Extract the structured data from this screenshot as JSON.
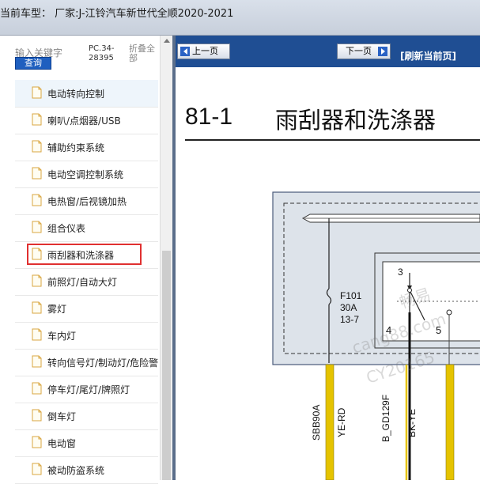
{
  "header": {
    "title": "当前车型：  厂家:J-江铃汽车新世代全顺2020-2021"
  },
  "search": {
    "keyword_label": "输入关键字",
    "button": "查询",
    "pc_code": "PC.34-28395",
    "fold": "折叠全部"
  },
  "tree": [
    {
      "label": "电动转向控制",
      "state": "active"
    },
    {
      "label": "喇叭/点烟器/USB"
    },
    {
      "label": "辅助约束系统"
    },
    {
      "label": "电动空调控制系统"
    },
    {
      "label": "电热窗/后视镜加热"
    },
    {
      "label": "组合仪表"
    },
    {
      "label": "雨刮器和洗涤器",
      "state": "highlighted"
    },
    {
      "label": "前照灯/自动大灯"
    },
    {
      "label": "雾灯"
    },
    {
      "label": "车内灯"
    },
    {
      "label": "转向信号灯/制动灯/危险警"
    },
    {
      "label": "停车灯/尾灯/牌照灯"
    },
    {
      "label": "倒车灯"
    },
    {
      "label": "电动窗"
    },
    {
      "label": "被动防盗系统"
    }
  ],
  "nav": {
    "prev": "上一页",
    "next": "下一页",
    "refresh": "[刷新当前页]"
  },
  "document": {
    "page_number": "81-1",
    "title": "雨刮器和洗涤器",
    "fuse": {
      "id": "F101",
      "rating": "30A",
      "ref": "13-7"
    },
    "pins": [
      "3",
      "4",
      "5"
    ],
    "wires": [
      {
        "circuit": "SBB90A",
        "color": "YE-RD"
      },
      {
        "circuit": "B_GD129F",
        "color": "BK-YE"
      }
    ],
    "watermark": [
      "畅易",
      "cang88.com",
      "CY20165"
    ]
  },
  "colors": {
    "navbar": "#1f4e93",
    "highlight_border": "#e03030",
    "wire_yellow": "#e5c300",
    "box_fill": "#dde3ea"
  }
}
